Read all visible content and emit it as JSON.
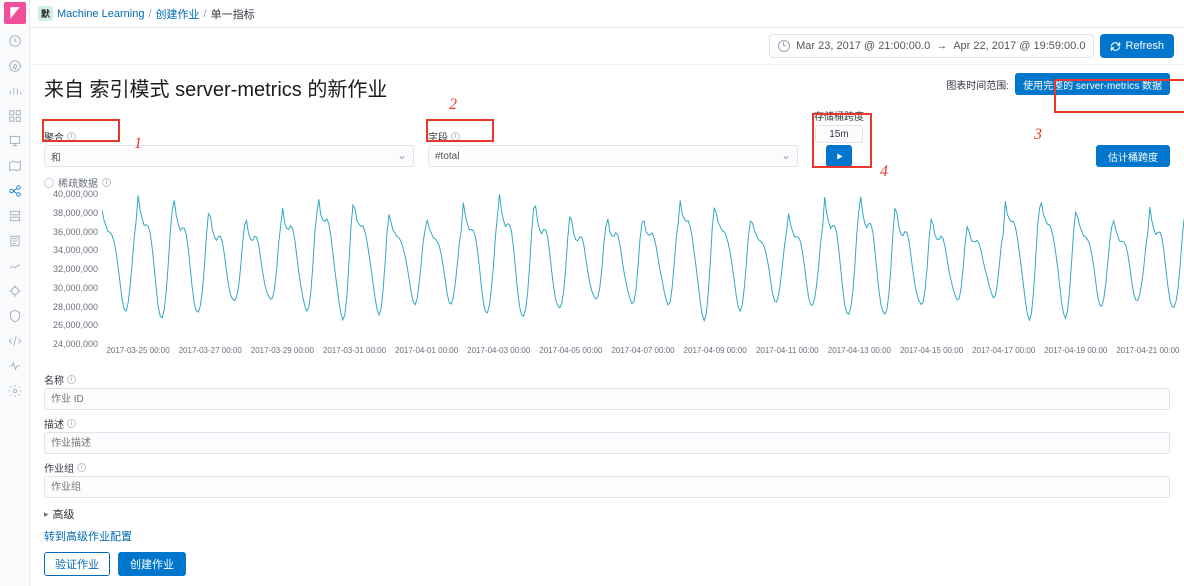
{
  "breadcrumb": {
    "badge": "默",
    "items": [
      "Machine Learning",
      "创建作业",
      "单一指标"
    ]
  },
  "time": {
    "start": "Mar 23, 2017 @ 21:00:00.0",
    "arrow": "→",
    "end": "Apr 22, 2017 @ 19:59:00.0",
    "refresh": "Refresh"
  },
  "page": {
    "title": "来自 索引模式 server-metrics 的新作业",
    "rangeLabel": "图表时间范围:",
    "useFull": "使用完整的 server-metrics 数据"
  },
  "fields": {
    "agg": {
      "label": "聚合",
      "value": "和"
    },
    "field": {
      "label": "字段",
      "value": "#total"
    },
    "span": {
      "label": "存储桶跨度",
      "value": "15m"
    },
    "estimate": "估计桶跨度",
    "sparse": "稀疏数据"
  },
  "annotations": {
    "a1": "1",
    "a2": "2",
    "a3": "3",
    "a4": "4"
  },
  "form": {
    "name": {
      "label": "名称",
      "ph": "作业 ID"
    },
    "desc": {
      "label": "描述",
      "ph": "作业描述"
    },
    "group": {
      "label": "作业组",
      "ph": "作业组"
    },
    "advanced": "高级",
    "gotoAdvanced": "转到高级作业配置",
    "validate": "验证作业",
    "create": "创建作业"
  },
  "chart_data": {
    "type": "line",
    "ylabel": "",
    "xlabel": "",
    "ylim": [
      24000000,
      40000000
    ],
    "yticks": [
      24000000,
      26000000,
      28000000,
      30000000,
      32000000,
      34000000,
      36000000,
      38000000,
      40000000
    ],
    "yticklabels": [
      "24,000,000",
      "26,000,000",
      "28,000,000",
      "30,000,000",
      "32,000,000",
      "34,000,000",
      "36,000,000",
      "38,000,000",
      "40,000,000"
    ],
    "xticklabels": [
      "2017-03-25 00:00",
      "2017-03-27 00:00",
      "2017-03-29 00:00",
      "2017-03-31 00:00",
      "2017-04-01 00:00",
      "2017-04-03 00:00",
      "2017-04-05 00:00",
      "2017-04-07 00:00",
      "2017-04-09 00:00",
      "2017-04-11 00:00",
      "2017-04-13 00:00",
      "2017-04-15 00:00",
      "2017-04-17 00:00",
      "2017-04-19 00:00",
      "2017-04-21 00:00"
    ],
    "cycles": 30,
    "cycle_shape": [
      39000000,
      37500000,
      36800000,
      36400000,
      36600000,
      36300000,
      35400000,
      33800000,
      32000000,
      30200000,
      28600000,
      27600000,
      27200000,
      27800000,
      29600000,
      32400000,
      35800000,
      38000000
    ]
  }
}
